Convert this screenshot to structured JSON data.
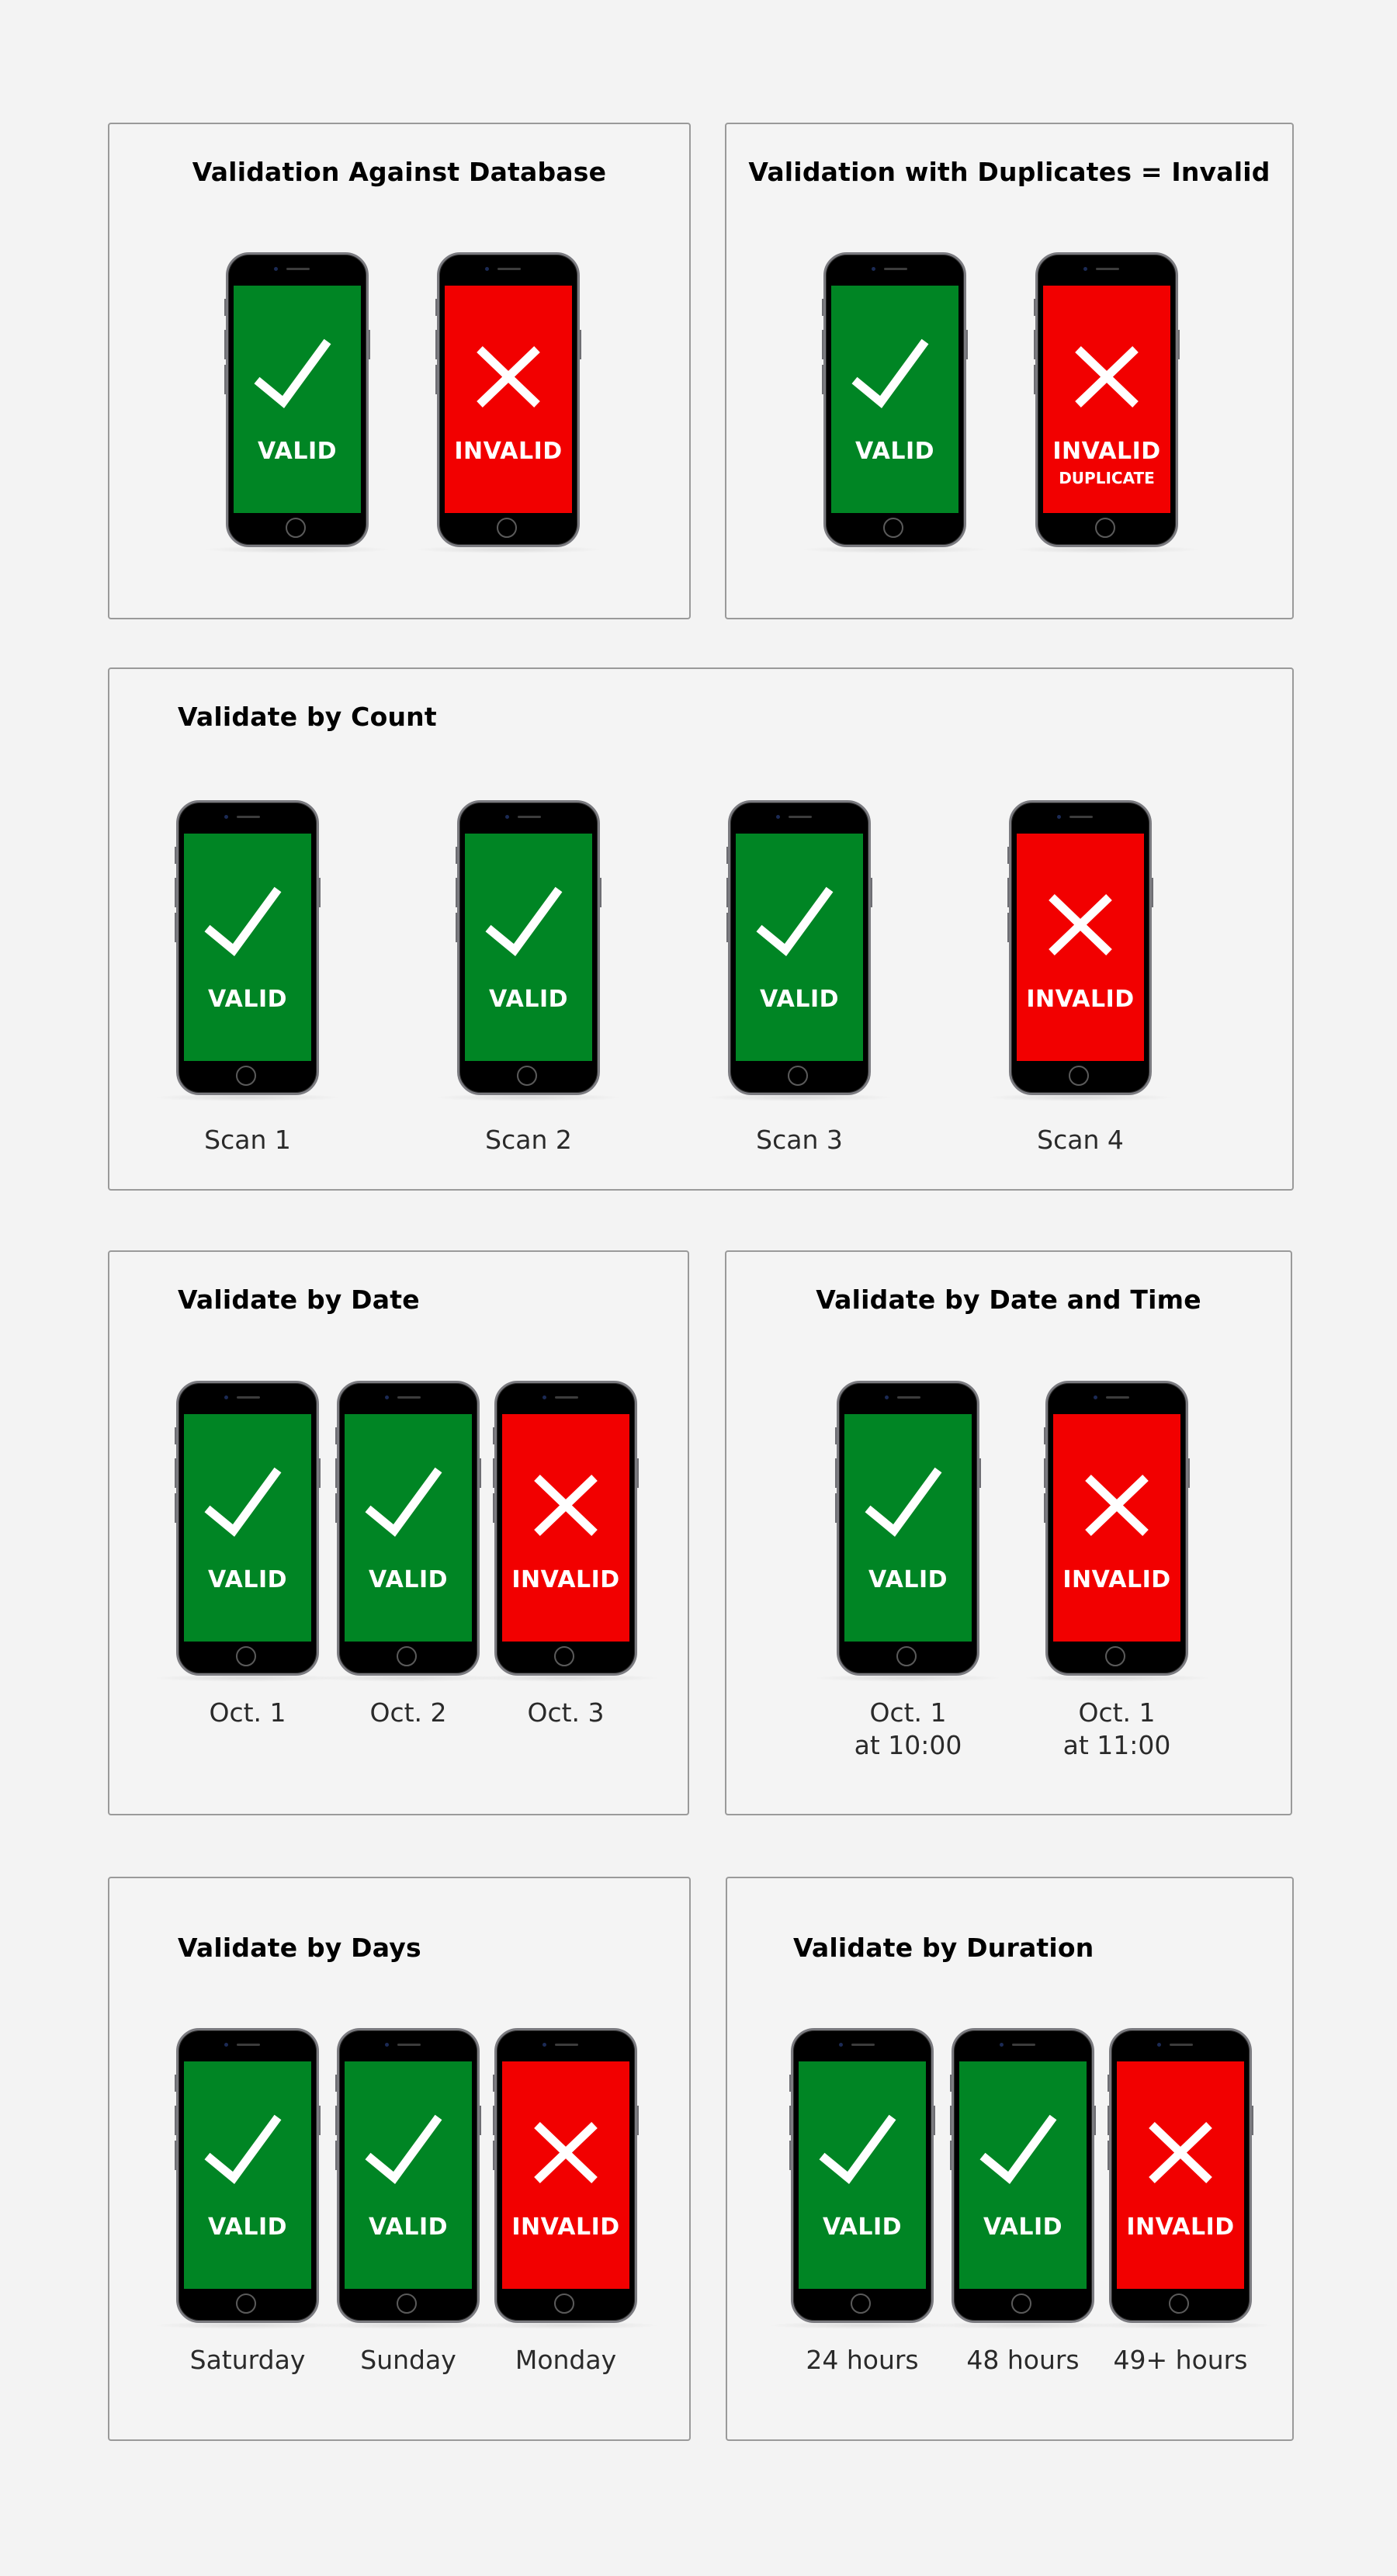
{
  "colors": {
    "valid_screen": "#008524",
    "invalid_screen": "#f20000",
    "panel_border": "#9a9a9a",
    "page_background": "#f3f3f3"
  },
  "panels": [
    {
      "id": "database",
      "title": "Validation Against Database",
      "phones": [
        {
          "status": "VALID",
          "state": "valid",
          "icon": "checkmark-icon",
          "sub": "",
          "caption": ""
        },
        {
          "status": "INVALID",
          "state": "invalid",
          "icon": "cross-icon",
          "sub": "",
          "caption": ""
        }
      ]
    },
    {
      "id": "duplicates",
      "title": "Validation with Duplicates = Invalid",
      "phones": [
        {
          "status": "VALID",
          "state": "valid",
          "icon": "checkmark-icon",
          "sub": "",
          "caption": ""
        },
        {
          "status": "INVALID",
          "state": "invalid",
          "icon": "cross-icon",
          "sub": "DUPLICATE",
          "caption": ""
        }
      ]
    },
    {
      "id": "count",
      "title": "Validate by Count",
      "phones": [
        {
          "status": "VALID",
          "state": "valid",
          "icon": "checkmark-icon",
          "sub": "",
          "caption": "Scan 1"
        },
        {
          "status": "VALID",
          "state": "valid",
          "icon": "checkmark-icon",
          "sub": "",
          "caption": "Scan 2"
        },
        {
          "status": "VALID",
          "state": "valid",
          "icon": "checkmark-icon",
          "sub": "",
          "caption": "Scan 3"
        },
        {
          "status": "INVALID",
          "state": "invalid",
          "icon": "cross-icon",
          "sub": "",
          "caption": "Scan 4"
        }
      ]
    },
    {
      "id": "date",
      "title": "Validate by Date",
      "phones": [
        {
          "status": "VALID",
          "state": "valid",
          "icon": "checkmark-icon",
          "sub": "",
          "caption": "Oct. 1"
        },
        {
          "status": "VALID",
          "state": "valid",
          "icon": "checkmark-icon",
          "sub": "",
          "caption": "Oct. 2"
        },
        {
          "status": "INVALID",
          "state": "invalid",
          "icon": "cross-icon",
          "sub": "",
          "caption": "Oct. 3"
        }
      ]
    },
    {
      "id": "datetime",
      "title": "Validate by Date and Time",
      "phones": [
        {
          "status": "VALID",
          "state": "valid",
          "icon": "checkmark-icon",
          "sub": "",
          "caption": "Oct. 1\nat 10:00"
        },
        {
          "status": "INVALID",
          "state": "invalid",
          "icon": "cross-icon",
          "sub": "",
          "caption": "Oct. 1\nat 11:00"
        }
      ]
    },
    {
      "id": "days",
      "title": "Validate by Days",
      "phones": [
        {
          "status": "VALID",
          "state": "valid",
          "icon": "checkmark-icon",
          "sub": "",
          "caption": "Saturday"
        },
        {
          "status": "VALID",
          "state": "valid",
          "icon": "checkmark-icon",
          "sub": "",
          "caption": "Sunday"
        },
        {
          "status": "INVALID",
          "state": "invalid",
          "icon": "cross-icon",
          "sub": "",
          "caption": "Monday"
        }
      ]
    },
    {
      "id": "duration",
      "title": "Validate by Duration",
      "phones": [
        {
          "status": "VALID",
          "state": "valid",
          "icon": "checkmark-icon",
          "sub": "",
          "caption": "24 hours"
        },
        {
          "status": "VALID",
          "state": "valid",
          "icon": "checkmark-icon",
          "sub": "",
          "caption": "48 hours"
        },
        {
          "status": "INVALID",
          "state": "invalid",
          "icon": "cross-icon",
          "sub": "",
          "caption": "49+ hours"
        }
      ]
    }
  ]
}
